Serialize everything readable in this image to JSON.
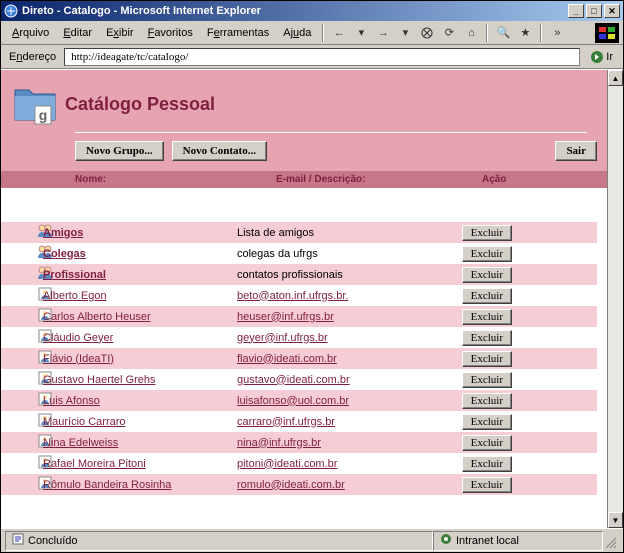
{
  "window": {
    "title": "Direto - Catalogo - Microsoft Internet Explorer"
  },
  "menu": {
    "arquivo": "Arquivo",
    "editar": "Editar",
    "exibir": "Exibir",
    "favoritos": "Favoritos",
    "ferramentas": "Ferramentas",
    "ajuda": "Ajuda"
  },
  "address": {
    "label": "Endereço",
    "url": "http://ideagate/tc/catalogo/",
    "go": "Ir"
  },
  "page": {
    "title": "Catálogo Pessoal",
    "new_group": "Novo Grupo...",
    "new_contact": "Novo Contato...",
    "exit": "Sair"
  },
  "columns": {
    "name": "Nome:",
    "email": "E-mail / Descrição:",
    "action": "Ação"
  },
  "delete_label": "Excluir",
  "items": [
    {
      "type": "group",
      "name": "Amigos",
      "desc": "Lista de amigos"
    },
    {
      "type": "group",
      "name": "Colegas",
      "desc": "colegas da ufrgs"
    },
    {
      "type": "group",
      "name": "Profissional",
      "desc": "contatos profissionais"
    },
    {
      "type": "contact",
      "name": "Alberto Egon",
      "email": "beto@aton.inf.ufrgs.br."
    },
    {
      "type": "contact",
      "name": "Carlos Alberto Heuser",
      "email": "heuser@inf.ufrgs.br"
    },
    {
      "type": "contact",
      "name": "Cláudio Geyer",
      "email": "geyer@inf.ufrgs.br"
    },
    {
      "type": "contact",
      "name": "Flávio (IdeaTI)",
      "email": "flavio@ideati.com.br"
    },
    {
      "type": "contact",
      "name": "Gustavo Haertel Grehs",
      "email": "gustavo@ideati.com.br"
    },
    {
      "type": "contact",
      "name": "Luis Afonso",
      "email": "luisafonso@uol.com.br"
    },
    {
      "type": "contact",
      "name": "Maurício Carraro",
      "email": "carraro@inf.ufrgs.br"
    },
    {
      "type": "contact",
      "name": "Nina Edelweiss",
      "email": "nina@inf.ufrgs.br"
    },
    {
      "type": "contact",
      "name": "Rafael Moreira Pitoni",
      "email": "pitoni@ideati.com.br"
    },
    {
      "type": "contact",
      "name": "Rômulo Bandeira Rosinha",
      "email": "romulo@ideati.com.br"
    }
  ],
  "status": {
    "left": "Concluído",
    "right": "Intranet local"
  }
}
